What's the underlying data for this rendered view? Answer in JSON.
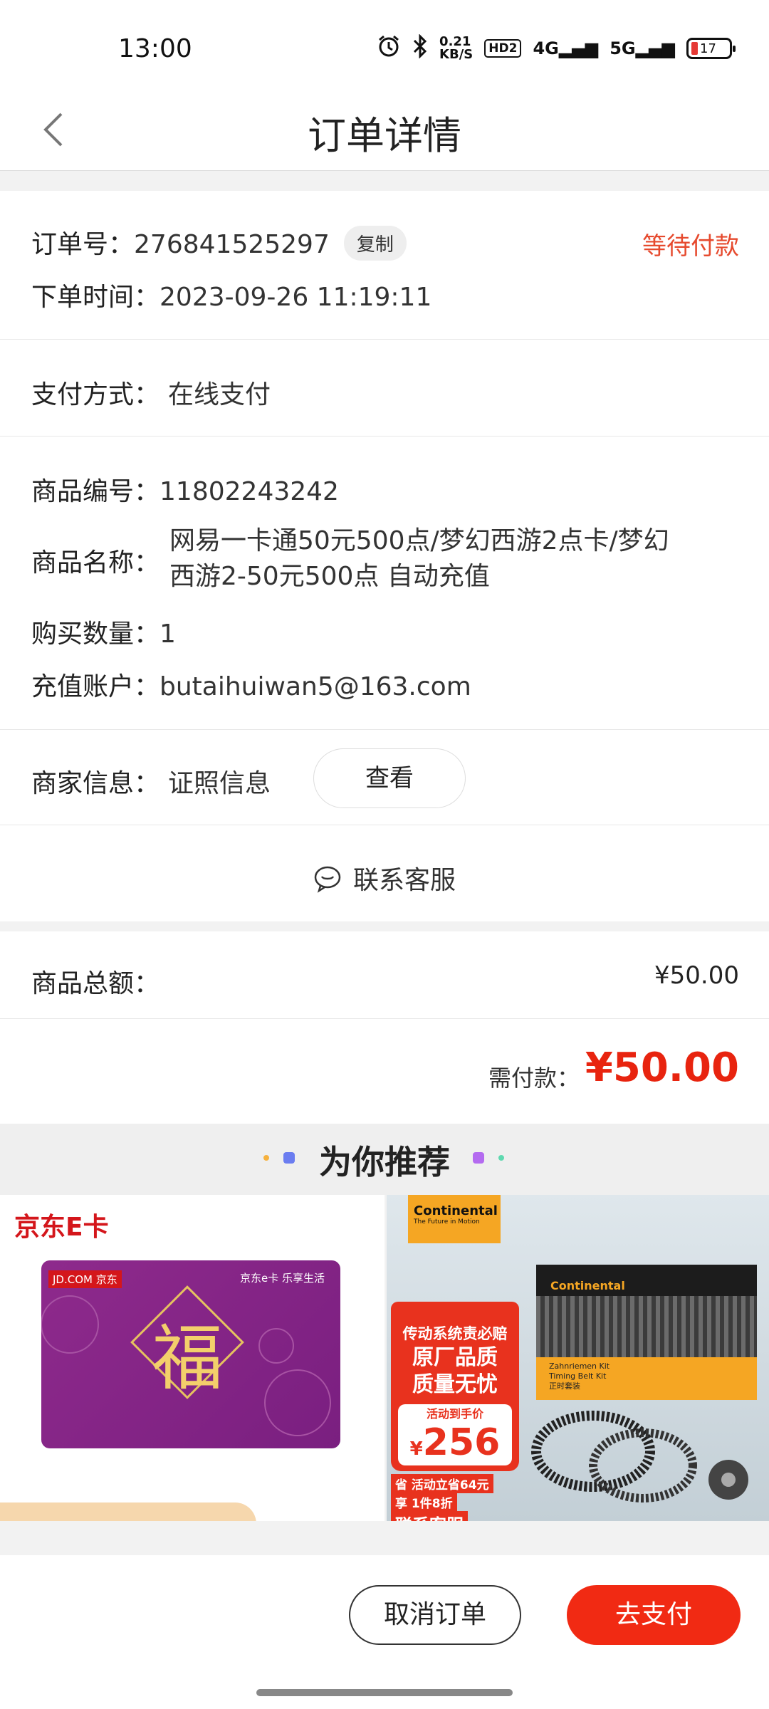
{
  "status_bar": {
    "time": "13:00",
    "net_speed_value": "0.21",
    "net_speed_unit": "KB/S",
    "hd_badge": "HD2",
    "sig1": "4G",
    "sig2": "5G",
    "battery_level": "17",
    "icons": [
      "alarm-icon",
      "bluetooth-icon"
    ]
  },
  "nav": {
    "title": "订单详情",
    "back_icon": "chevron-left-icon"
  },
  "order": {
    "number_label": "订单号：",
    "number": "276841525297",
    "copy_label": "复制",
    "status": "等待付款",
    "time_label": "下单时间：",
    "time": "2023-09-26 11:19:11"
  },
  "payment": {
    "label": "支付方式：",
    "value": "在线支付"
  },
  "product": {
    "id_label": "商品编号：",
    "id": "11802243242",
    "name_label": "商品名称：",
    "name_line1": "网易一卡通50元500点/梦幻西游2点卡/梦幻",
    "name_line2": "西游2-50元500点 自动充值",
    "qty_label": "购买数量：",
    "qty": "1",
    "account_label": "充值账户：",
    "account": "butaihuiwan5@163.com"
  },
  "merchant": {
    "label": "商家信息：",
    "value": "证照信息",
    "view_label": "查看"
  },
  "service": {
    "label": "联系客服"
  },
  "totals": {
    "goods_label": "商品总额：",
    "goods_amount": "¥50.00",
    "pay_label": "需付款：",
    "pay_amount": "¥50.00"
  },
  "recommend": {
    "title": "为你推荐",
    "left": {
      "brand": "京东E卡",
      "card_top_left": "JD.COM 京东",
      "card_top_right": "京东e卡 乐享生活",
      "card_glyph": "福"
    },
    "right": {
      "brand": "Continental",
      "tagline": "The Future in Motion",
      "box_brand": "Continental",
      "box_text1": "Zahnriemen Kit",
      "box_text2": "Timing Belt Kit",
      "box_text3": "正时套装",
      "promo1": "传动系统责必赔",
      "promo2": "原厂品质",
      "promo3": "质量无忧",
      "promo4": "活动到手价",
      "price_symbol": "¥",
      "price": "256",
      "promo5": "省 活动立省64元",
      "promo6": "享 1件8折",
      "promo7": "联系客服"
    }
  },
  "actions": {
    "cancel": "取消订单",
    "pay": "去支付"
  },
  "colors": {
    "accent": "#e64a2e",
    "pay_red": "#f12a13"
  }
}
